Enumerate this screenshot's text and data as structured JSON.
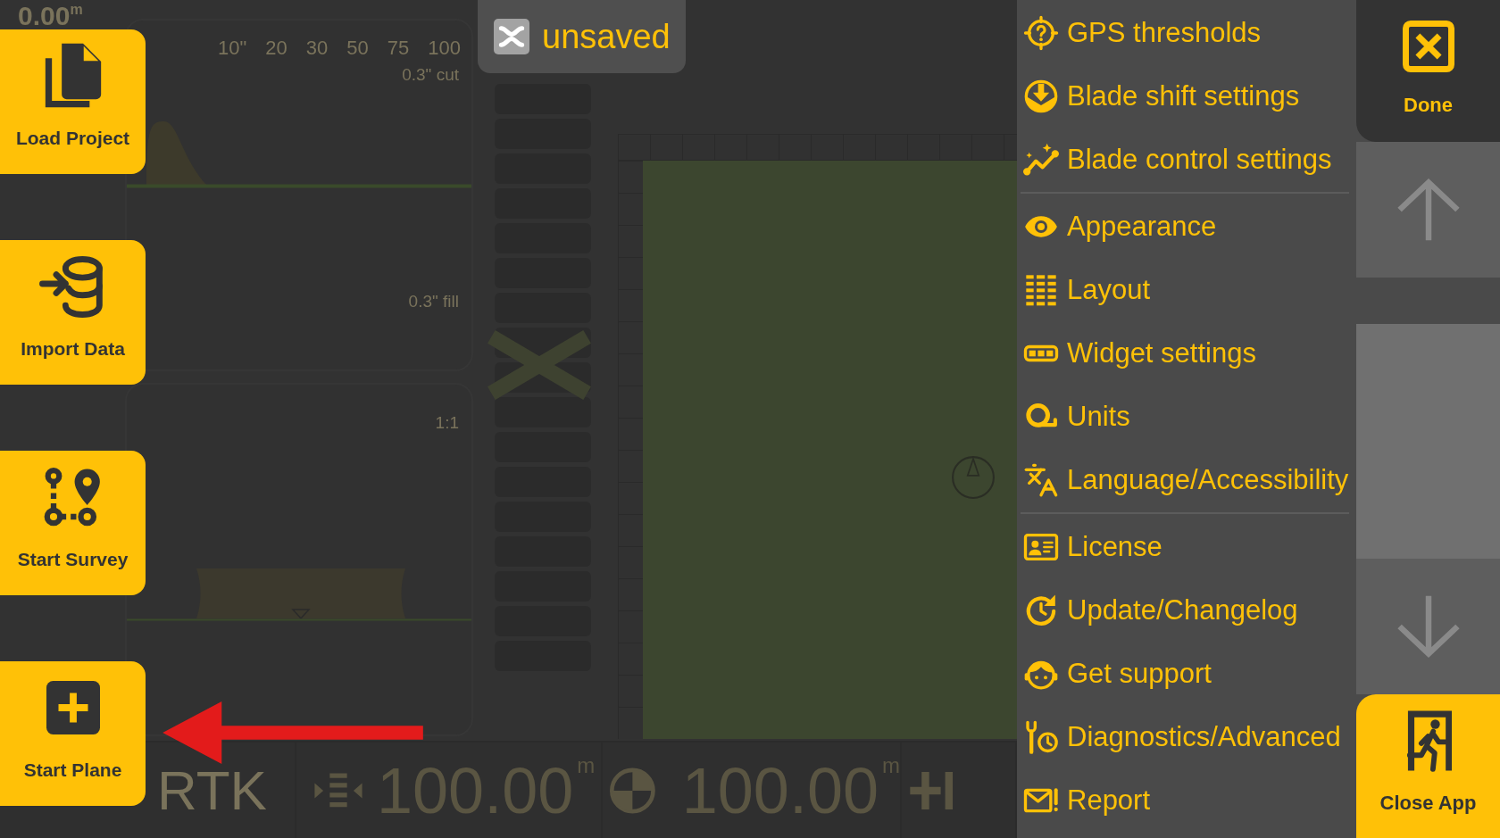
{
  "background_app": {
    "depth_readout": {
      "value": "0.00",
      "unit": "m"
    },
    "profile_panel": {
      "scale_ticks": [
        "10\"",
        "20",
        "30",
        "50",
        "75",
        "100"
      ],
      "cut_label": "0.3\" cut",
      "fill_label": "0.3\" fill"
    },
    "section_panel": {
      "scale_label": "1:1"
    },
    "status_bar": {
      "gps_mode": "RTK",
      "readouts": [
        {
          "kind": "width",
          "value": "100.00",
          "unit": "m"
        },
        {
          "kind": "target",
          "value": "100.00",
          "unit": "m"
        }
      ]
    }
  },
  "quick_actions": [
    {
      "kind": "load_project",
      "label": "Load Project"
    },
    {
      "kind": "import_data",
      "label": "Import Data"
    },
    {
      "kind": "start_survey",
      "label": "Start Survey"
    },
    {
      "kind": "start_plane",
      "label": "Start Plane"
    }
  ],
  "project_status": {
    "label": "unsaved"
  },
  "settings_menu": {
    "groups": [
      {
        "items": [
          {
            "kind": "gps",
            "label": "GPS thresholds"
          },
          {
            "kind": "blade_shift",
            "label": "Blade shift settings"
          },
          {
            "kind": "blade_control",
            "label": "Blade control settings"
          }
        ]
      },
      {
        "items": [
          {
            "kind": "appearance",
            "label": "Appearance"
          },
          {
            "kind": "layout",
            "label": "Layout"
          },
          {
            "kind": "widget",
            "label": "Widget settings"
          },
          {
            "kind": "units",
            "label": "Units"
          },
          {
            "kind": "language",
            "label": "Language/Accessibility"
          }
        ]
      },
      {
        "items": [
          {
            "kind": "license",
            "label": "License"
          },
          {
            "kind": "update",
            "label": "Update/Changelog"
          },
          {
            "kind": "support",
            "label": "Get support"
          },
          {
            "kind": "diagnostics",
            "label": "Diagnostics/Advanced"
          },
          {
            "kind": "report",
            "label": "Report"
          }
        ]
      }
    ]
  },
  "side_controls": {
    "done_label": "Done",
    "close_label": "Close App"
  }
}
